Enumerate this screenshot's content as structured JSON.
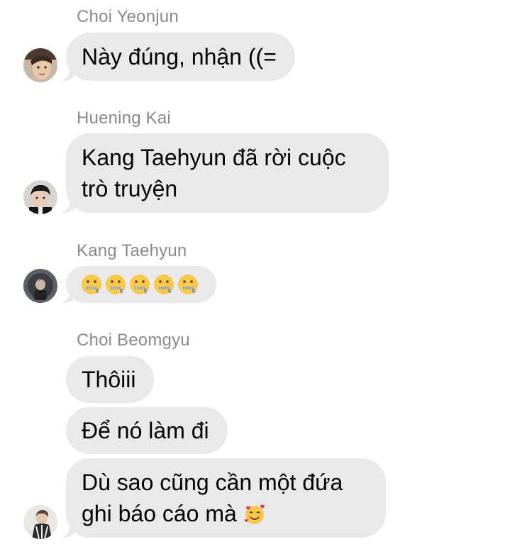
{
  "messages": [
    {
      "sender": "Choi Yeonjun",
      "avatar_icon": "avatar-choi-yeonjun",
      "bubbles": [
        "Này đúng, nhận ((="
      ]
    },
    {
      "sender": "Huening Kai",
      "avatar_icon": "avatar-huening-kai",
      "bubbles": [
        "Kang Taehyun đã rời cuộc\ntrò truyện"
      ]
    },
    {
      "sender": "Kang Taehyun",
      "avatar_icon": "avatar-kang-taehyun",
      "bubbles": [],
      "emoji": {
        "name": "zipper-mouth-face-icon",
        "count": 5
      }
    },
    {
      "sender": "Choi Beomgyu",
      "avatar_icon": "avatar-choi-beomgyu",
      "bubbles": [
        "Thôiii",
        "Để nó làm đi",
        "Dù sao cũng cần một đứa\nghi báo cáo mà"
      ],
      "trailing_emoji": "smiling-face-with-hearts-icon"
    }
  ],
  "colors": {
    "bubble": "#e9e9eb",
    "sender_name": "#8a8a8e",
    "text": "#000000"
  }
}
